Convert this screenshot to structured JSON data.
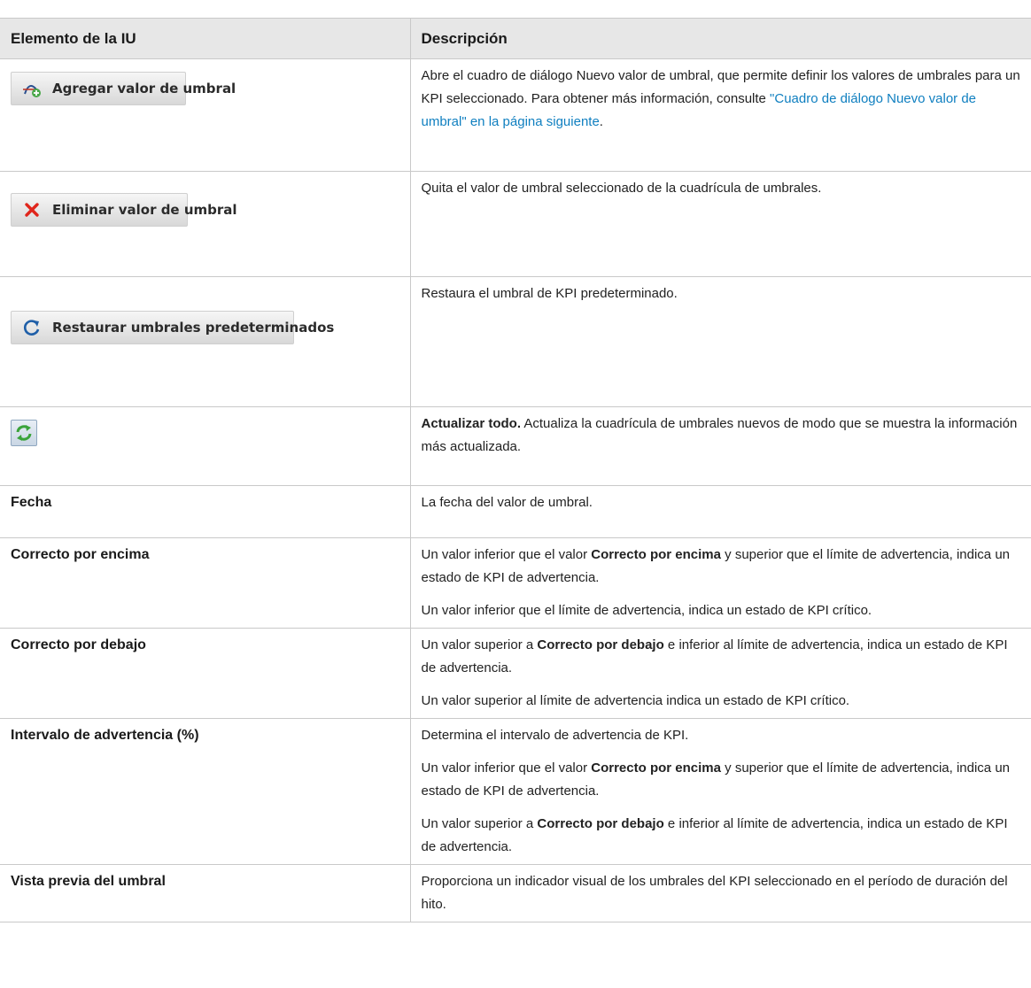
{
  "table": {
    "header": {
      "col1": "Elemento de la IU",
      "col2": "Descripción"
    },
    "rows": [
      {
        "type": "button",
        "icon": "add-threshold-icon",
        "button_label": "Agregar valor de umbral",
        "desc_before": "Abre el cuadro de diálogo Nuevo valor de umbral, que permite definir los valores de umbrales para un KPI seleccionado. Para obtener más información, consulte ",
        "desc_link": "\"Cuadro de diálogo Nuevo valor de umbral\" en la página siguiente",
        "desc_after": "."
      },
      {
        "type": "button",
        "icon": "delete-x-icon",
        "button_label": "Eliminar valor de umbral",
        "desc": "Quita el valor de umbral seleccionado de la cuadrícula de umbrales."
      },
      {
        "type": "button",
        "icon": "restore-icon",
        "button_label": "Restaurar umbrales predeterminados",
        "desc": "Restaura el umbral de KPI predeterminado."
      },
      {
        "type": "icon-button",
        "icon": "refresh-all-icon",
        "desc_bold": "Actualizar todo.",
        "desc_rest": " Actualiza la cuadrícula de umbrales nuevos de modo que se muestra la información más actualizada."
      },
      {
        "type": "field",
        "label": "Fecha",
        "desc": "La fecha del valor de umbral."
      },
      {
        "type": "field",
        "label": "Correcto por encima",
        "p1_before": "Un valor inferior que el valor ",
        "p1_bold": "Correcto por encima",
        "p1_after": " y superior que el límite de advertencia, indica un estado de KPI de advertencia.",
        "p2": "Un valor inferior que el límite de advertencia, indica un estado de KPI crítico."
      },
      {
        "type": "field",
        "label": "Correcto por debajo",
        "p1_before": "Un valor superior a ",
        "p1_bold": "Correcto por debajo",
        "p1_after": " e inferior al límite de advertencia, indica un estado de KPI de advertencia.",
        "p2": "Un valor superior al límite de advertencia indica un estado de KPI crítico."
      },
      {
        "type": "field",
        "label": "Intervalo de advertencia (%)",
        "p1": "Determina el intervalo de advertencia de KPI.",
        "p2_before": "Un valor inferior que el valor ",
        "p2_bold": "Correcto por encima",
        "p2_after": " y superior que el límite de advertencia, indica un estado de KPI de advertencia.",
        "p3_before": "Un valor superior a ",
        "p3_bold": "Correcto por debajo",
        "p3_after": " e inferior al límite de advertencia, indica un estado de KPI de advertencia."
      },
      {
        "type": "field",
        "label": "Vista previa del umbral",
        "desc": "Proporciona un indicador visual de los umbrales del KPI seleccionado en el período de duración del hito."
      }
    ]
  },
  "colors": {
    "link": "#0f7fc0",
    "header_bg": "#e7e7e7",
    "border": "#c9c9c9",
    "delete_red": "#e0261c",
    "restore_blue": "#1f5fa8",
    "refresh_green": "#3aa33a"
  }
}
